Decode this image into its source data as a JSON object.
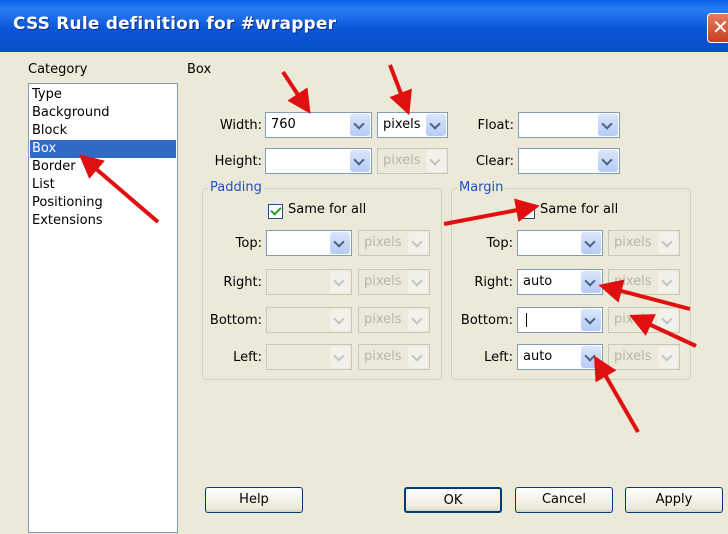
{
  "window": {
    "title": "CSS Rule definition for #wrapper"
  },
  "category": {
    "heading": "Category",
    "items": [
      {
        "label": "Type"
      },
      {
        "label": "Background"
      },
      {
        "label": "Block"
      },
      {
        "label": "Box",
        "selected": true
      },
      {
        "label": "Border"
      },
      {
        "label": "List"
      },
      {
        "label": "Positioning"
      },
      {
        "label": "Extensions"
      }
    ]
  },
  "panel": {
    "heading": "Box",
    "width": {
      "label": "Width:",
      "value": "760",
      "unit": "pixels"
    },
    "height": {
      "label": "Height:",
      "value": "",
      "unit": "pixels"
    },
    "float": {
      "label": "Float:",
      "value": ""
    },
    "clear": {
      "label": "Clear:",
      "value": ""
    }
  },
  "padding": {
    "legend": "Padding",
    "same_for_all": {
      "label": "Same for all",
      "checked": true
    },
    "top": {
      "label": "Top:",
      "value": "",
      "unit": "pixels"
    },
    "right": {
      "label": "Right:",
      "value": "",
      "unit": "pixels"
    },
    "bottom": {
      "label": "Bottom:",
      "value": "",
      "unit": "pixels"
    },
    "left": {
      "label": "Left:",
      "value": "",
      "unit": "pixels"
    }
  },
  "margin": {
    "legend": "Margin",
    "same_for_all": {
      "label": "Same for all",
      "checked": false
    },
    "top": {
      "label": "Top:",
      "value": "",
      "unit": "pixels"
    },
    "right": {
      "label": "Right:",
      "value": "auto",
      "unit": "pixels"
    },
    "bottom": {
      "label": "Bottom:",
      "value": "",
      "unit": "pixels"
    },
    "left": {
      "label": "Left:",
      "value": "auto",
      "unit": "pixels"
    }
  },
  "buttons": {
    "help": "Help",
    "ok": "OK",
    "cancel": "Cancel",
    "apply": "Apply"
  },
  "colors": {
    "titlebar": "#0a56d8",
    "selection": "#316ac5",
    "annotation_arrow": "#e01010",
    "group_legend": "#1f4fc8"
  },
  "icons": [
    "close-icon",
    "chevron-down-icon",
    "checkbox-icon",
    "annotation-arrow-icon"
  ]
}
